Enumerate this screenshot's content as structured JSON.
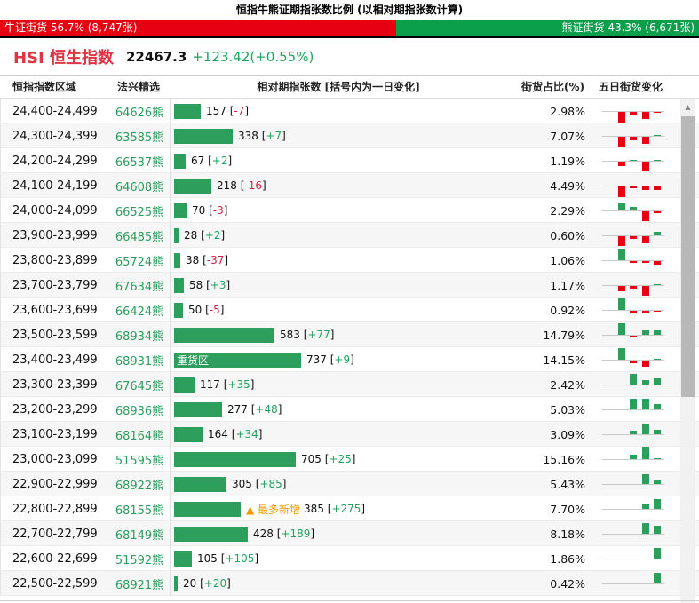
{
  "title": "恒指牛熊证期指张数比例 (以相对期指张数计算)",
  "ratio_bar": {
    "bull_label": "牛证街货 56.7% (8,747张)",
    "bull_pct": 56.7,
    "bull_color": "#e60012",
    "bear_label": "熊证街货 43.3% (6,671张)",
    "bear_pct": 43.3,
    "bear_color": "#0b9e4b"
  },
  "index_header": {
    "name": "HSI 恒生指数",
    "price": "22467.3",
    "change": "+123.42(+0.55%)"
  },
  "table": {
    "columns": [
      "恒指指数区域",
      "法兴精选",
      "相对期指张数 [括号内为一日变化]",
      "街货占比(%)",
      "五日街货变化"
    ],
    "heavy_zone_label": "重货区",
    "most_new_label": "▲ 最多新增",
    "rows": [
      {
        "range": "24,400-24,499",
        "code": "64626熊",
        "value": 157,
        "change": "-7",
        "pct": "2.98%",
        "tag_in_bar": "",
        "tag_after_bar": "",
        "five_day": [
          0,
          -13,
          -4,
          -8,
          -1
        ]
      },
      {
        "range": "24,300-24,399",
        "code": "63585熊",
        "value": 338,
        "change": "+7",
        "pct": "7.07%",
        "tag_in_bar": "",
        "tag_after_bar": "",
        "five_day": [
          0,
          -12,
          -4,
          -8,
          1
        ]
      },
      {
        "range": "24,200-24,299",
        "code": "66537熊",
        "value": 67,
        "change": "+2",
        "pct": "1.19%",
        "tag_in_bar": "",
        "tag_after_bar": "",
        "five_day": [
          0,
          -5,
          1,
          -11,
          1
        ]
      },
      {
        "range": "24,100-24,199",
        "code": "64608熊",
        "value": 218,
        "change": "-16",
        "pct": "4.49%",
        "tag_in_bar": "",
        "tag_after_bar": "",
        "five_day": [
          0,
          -12,
          -2,
          -4,
          -4
        ]
      },
      {
        "range": "24,000-24,099",
        "code": "66525熊",
        "value": 70,
        "change": "-3",
        "pct": "2.29%",
        "tag_in_bar": "",
        "tag_after_bar": "",
        "five_day": [
          0,
          8,
          4,
          -11,
          -2
        ]
      },
      {
        "range": "23,900-23,999",
        "code": "66485熊",
        "value": 28,
        "change": "+2",
        "pct": "0.60%",
        "tag_in_bar": "",
        "tag_after_bar": "",
        "five_day": [
          0,
          -11,
          -3,
          -8,
          4
        ]
      },
      {
        "range": "23,800-23,899",
        "code": "65724熊",
        "value": 38,
        "change": "-37",
        "pct": "1.06%",
        "tag_in_bar": "",
        "tag_after_bar": "",
        "five_day": [
          0,
          13,
          -2,
          -2,
          -4
        ]
      },
      {
        "range": "23,700-23,799",
        "code": "67634熊",
        "value": 58,
        "change": "+3",
        "pct": "1.17%",
        "tag_in_bar": "",
        "tag_after_bar": "",
        "five_day": [
          0,
          -6,
          -3,
          -11,
          1
        ]
      },
      {
        "range": "23,600-23,699",
        "code": "66424熊",
        "value": 50,
        "change": "-5",
        "pct": "0.92%",
        "tag_in_bar": "",
        "tag_after_bar": "",
        "five_day": [
          0,
          13,
          -3,
          -2,
          -1
        ]
      },
      {
        "range": "23,500-23,599",
        "code": "68934熊",
        "value": 583,
        "change": "+77",
        "pct": "14.79%",
        "tag_in_bar": "",
        "tag_after_bar": "",
        "five_day": [
          0,
          13,
          -2,
          5,
          5
        ]
      },
      {
        "range": "23,400-23,499",
        "code": "68931熊",
        "value": 737,
        "change": "+9",
        "pct": "14.15%",
        "tag_in_bar": "重货区",
        "tag_after_bar": "",
        "five_day": [
          0,
          13,
          -3,
          -7,
          1
        ]
      },
      {
        "range": "23,300-23,399",
        "code": "67645熊",
        "value": 117,
        "change": "+35",
        "pct": "2.42%",
        "tag_in_bar": "",
        "tag_after_bar": "",
        "five_day": [
          0,
          0,
          12,
          5,
          7
        ]
      },
      {
        "range": "23,200-23,299",
        "code": "68936熊",
        "value": 277,
        "change": "+48",
        "pct": "5.03%",
        "tag_in_bar": "",
        "tag_after_bar": "",
        "five_day": [
          0,
          0,
          12,
          12,
          6
        ]
      },
      {
        "range": "23,100-23,199",
        "code": "68164熊",
        "value": 164,
        "change": "+34",
        "pct": "3.09%",
        "tag_in_bar": "",
        "tag_after_bar": "",
        "five_day": [
          0,
          0,
          4,
          12,
          5
        ]
      },
      {
        "range": "23,000-23,099",
        "code": "51595熊",
        "value": 705,
        "change": "+25",
        "pct": "15.16%",
        "tag_in_bar": "",
        "tag_after_bar": "",
        "five_day": [
          0,
          0,
          5,
          14,
          1
        ]
      },
      {
        "range": "22,900-22,999",
        "code": "68922熊",
        "value": 305,
        "change": "+85",
        "pct": "5.43%",
        "tag_in_bar": "",
        "tag_after_bar": "",
        "five_day": [
          0,
          0,
          0,
          11,
          4
        ]
      },
      {
        "range": "22,800-22,899",
        "code": "68155熊",
        "value": 385,
        "change": "+275",
        "pct": "7.70%",
        "tag_in_bar": "",
        "tag_after_bar": "▲ 最多新增",
        "five_day": [
          0,
          0,
          0,
          5,
          11
        ]
      },
      {
        "range": "22,700-22,799",
        "code": "68149熊",
        "value": 428,
        "change": "+189",
        "pct": "8.18%",
        "tag_in_bar": "",
        "tag_after_bar": "",
        "five_day": [
          0,
          0,
          0,
          12,
          9
        ]
      },
      {
        "range": "22,600-22,699",
        "code": "51592熊",
        "value": 105,
        "change": "+105",
        "pct": "1.86%",
        "tag_in_bar": "",
        "tag_after_bar": "",
        "five_day": [
          0,
          0,
          0,
          0,
          12
        ]
      },
      {
        "range": "22,500-22,599",
        "code": "68921熊",
        "value": 20,
        "change": "+20",
        "pct": "0.42%",
        "tag_in_bar": "",
        "tag_after_bar": "",
        "five_day": [
          0,
          0,
          0,
          0,
          12
        ]
      }
    ]
  },
  "colors": {
    "bar_green": "#2e9e5c",
    "mini_red": "#e60012",
    "change_pos": "#23a35f",
    "change_neg": "#cc2244",
    "most_new_orange": "#f39800"
  },
  "scrollbar": {
    "up_arrow": "▲"
  }
}
